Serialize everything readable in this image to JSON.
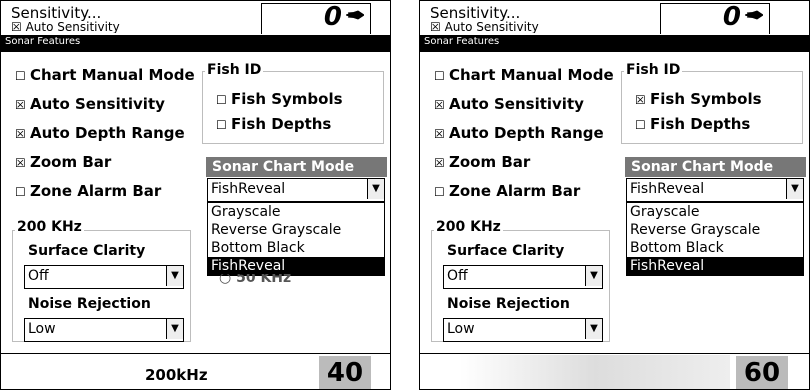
{
  "screens": [
    {
      "sensitivity_label": "Sensitivity...",
      "auto_sensitivity_partial": "☒ Auto Sensitivity",
      "depth": "0",
      "title": "Sonar Features",
      "checkboxes": [
        {
          "mark": "☐",
          "label": "Chart Manual Mode"
        },
        {
          "mark": "☒",
          "label": "Auto Sensitivity"
        },
        {
          "mark": "☒",
          "label": "Auto Depth Range"
        },
        {
          "mark": "☒",
          "label": "Zoom Bar"
        },
        {
          "mark": "☐",
          "label": "Zone Alarm Bar"
        }
      ],
      "fish_id_label": "Fish ID",
      "fish_symbols": {
        "mark": "☐",
        "label": "Fish Symbols"
      },
      "fish_depths": {
        "mark": "☐",
        "label": "Fish Depths"
      },
      "sonar_chart_mode_label": "Sonar Chart Mode",
      "sonar_chart_mode_value": "FishReveal",
      "dropdown_options": [
        "Grayscale",
        "Reverse Grayscale",
        "Bottom Black",
        "FishReveal"
      ],
      "dropdown_selected": "FishReveal",
      "under_text": "50 KHz",
      "khz_group_label": "200 KHz",
      "surface_clarity_label": "Surface Clarity",
      "surface_clarity_value": "Off",
      "noise_rejection_label": "Noise Rejection",
      "noise_rejection_value": "Low",
      "status_freq": "200kHz",
      "status_speed": "40"
    },
    {
      "sensitivity_label": "Sensitivity...",
      "auto_sensitivity_partial": "☒ Auto Sensitivity",
      "depth": "0",
      "title": "Sonar Features",
      "checkboxes": [
        {
          "mark": "☐",
          "label": "Chart Manual Mode"
        },
        {
          "mark": "☒",
          "label": "Auto Sensitivity"
        },
        {
          "mark": "☒",
          "label": "Auto Depth Range"
        },
        {
          "mark": "☒",
          "label": "Zoom Bar"
        },
        {
          "mark": "☐",
          "label": "Zone Alarm Bar"
        }
      ],
      "fish_id_label": "Fish ID",
      "fish_symbols": {
        "mark": "☒",
        "label": "Fish Symbols"
      },
      "fish_depths": {
        "mark": "☐",
        "label": "Fish Depths"
      },
      "sonar_chart_mode_label": "Sonar Chart Mode",
      "sonar_chart_mode_value": "FishReveal",
      "dropdown_options": [
        "Grayscale",
        "Reverse Grayscale",
        "Bottom Black",
        "FishReveal"
      ],
      "dropdown_selected": "FishReveal",
      "khz_group_label": "200 KHz",
      "surface_clarity_label": "Surface Clarity",
      "surface_clarity_value": "Off",
      "noise_rejection_label": "Noise Rejection",
      "noise_rejection_value": "Low",
      "status_freq": "",
      "status_speed": "60"
    }
  ]
}
